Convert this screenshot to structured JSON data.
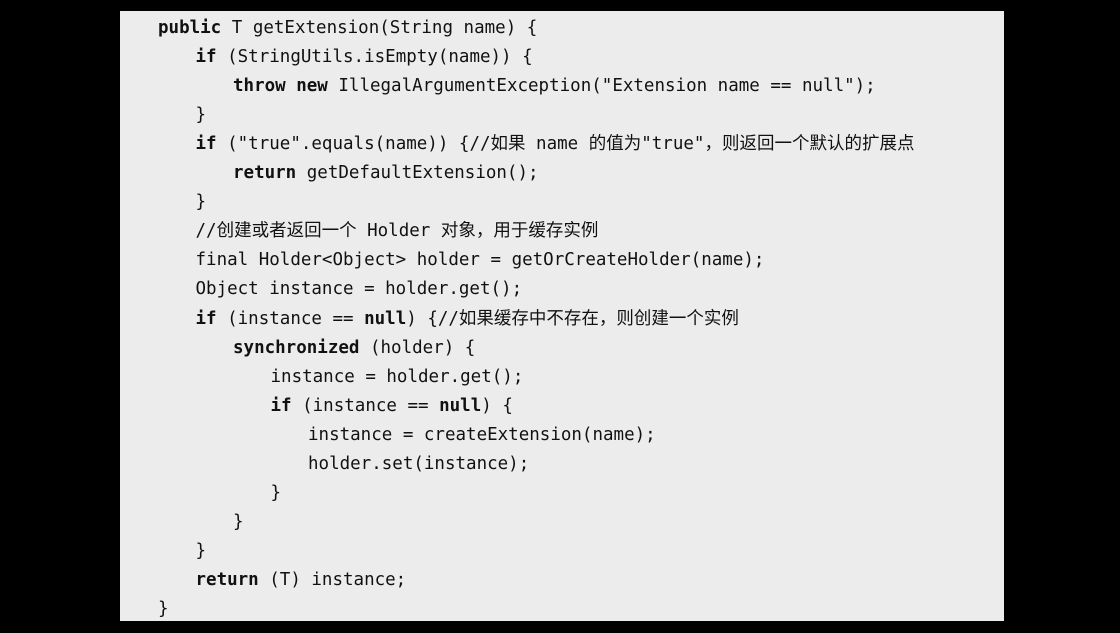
{
  "code": {
    "lines": [
      {
        "indent": 1,
        "tokens": [
          {
            "t": "public",
            "kw": true
          },
          {
            "t": " T getExtension(String name) {"
          }
        ]
      },
      {
        "indent": 2,
        "tokens": [
          {
            "t": "if",
            "kw": true
          },
          {
            "t": " (StringUtils.isEmpty(name)) {"
          }
        ]
      },
      {
        "indent": 3,
        "tokens": [
          {
            "t": "throw",
            "kw": true
          },
          {
            "t": " "
          },
          {
            "t": "new",
            "kw": true
          },
          {
            "t": " IllegalArgumentException(\"Extension name == null\");"
          }
        ]
      },
      {
        "indent": 2,
        "tokens": [
          {
            "t": "}"
          }
        ]
      },
      {
        "indent": 2,
        "tokens": [
          {
            "t": "if",
            "kw": true
          },
          {
            "t": " (\"true\".equals(name)) {//如果 name 的值为\"true\"，则返回一个默认的扩展点"
          }
        ]
      },
      {
        "indent": 3,
        "tokens": [
          {
            "t": "return",
            "kw": true
          },
          {
            "t": " getDefaultExtension();"
          }
        ]
      },
      {
        "indent": 2,
        "tokens": [
          {
            "t": "}"
          }
        ]
      },
      {
        "indent": 2,
        "tokens": [
          {
            "t": "//创建或者返回一个 Holder 对象，用于缓存实例"
          }
        ]
      },
      {
        "indent": 2,
        "tokens": [
          {
            "t": "final Holder<Object> holder = getOrCreateHolder(name);"
          }
        ]
      },
      {
        "indent": 2,
        "tokens": [
          {
            "t": "Object instance = holder.get();"
          }
        ]
      },
      {
        "indent": 2,
        "tokens": [
          {
            "t": "if",
            "kw": true
          },
          {
            "t": " (instance == "
          },
          {
            "t": "null",
            "kw": true
          },
          {
            "t": ") {//如果缓存中不存在，则创建一个实例"
          }
        ]
      },
      {
        "indent": 3,
        "tokens": [
          {
            "t": "synchronized",
            "kw": true
          },
          {
            "t": " (holder) {"
          }
        ]
      },
      {
        "indent": 4,
        "tokens": [
          {
            "t": "instance = holder.get();"
          }
        ]
      },
      {
        "indent": 4,
        "tokens": [
          {
            "t": "if",
            "kw": true
          },
          {
            "t": " (instance == "
          },
          {
            "t": "null",
            "kw": true
          },
          {
            "t": ") {"
          }
        ]
      },
      {
        "indent": 5,
        "tokens": [
          {
            "t": "instance = createExtension(name);"
          }
        ]
      },
      {
        "indent": 5,
        "tokens": [
          {
            "t": "holder.set(instance);"
          }
        ]
      },
      {
        "indent": 4,
        "tokens": [
          {
            "t": "}"
          }
        ]
      },
      {
        "indent": 3,
        "tokens": [
          {
            "t": "}"
          }
        ]
      },
      {
        "indent": 2,
        "tokens": [
          {
            "t": "}"
          }
        ]
      },
      {
        "indent": 2,
        "tokens": [
          {
            "t": "return",
            "kw": true
          },
          {
            "t": " (T) instance;"
          }
        ]
      },
      {
        "indent": 1,
        "tokens": [
          {
            "t": "}"
          }
        ]
      }
    ]
  },
  "colors": {
    "code_background": "#ececec",
    "page_background": "#000000",
    "text": "#111111"
  }
}
